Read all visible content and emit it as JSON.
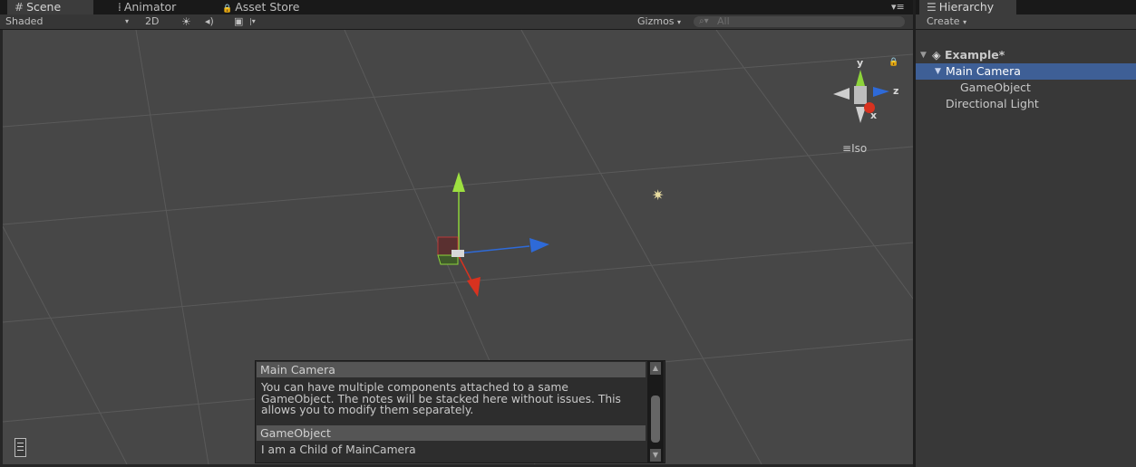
{
  "scene_tabs": [
    {
      "label": "Scene",
      "icon": "grid-icon",
      "icon_glyph": "#"
    },
    {
      "label": "Animator",
      "icon": "animator-icon",
      "icon_glyph": "⁞"
    },
    {
      "label": "Asset Store",
      "icon": "lock-icon",
      "icon_glyph": "🔒"
    }
  ],
  "scene_toolbar": {
    "shading": "Shaded",
    "mode_2d": "2D",
    "gizmos": "Gizmos",
    "search_placeholder": "All"
  },
  "orientation": {
    "y_label": "y",
    "z_label": "z",
    "x_label": "x",
    "projection": "Iso"
  },
  "notes": [
    {
      "title": "Main Camera",
      "body": "You can have multiple components attached to a same GameObject. The notes will be stacked here without issues. This allows you to modify them separately."
    },
    {
      "title": "GameObject",
      "body": "I am a Child of MainCamera"
    }
  ],
  "hierarchy": {
    "tab": "Hierarchy",
    "create": "Create",
    "scene": "Example*",
    "items": [
      {
        "label": "Main Camera",
        "selected": true
      },
      {
        "label": "GameObject",
        "selected": false
      },
      {
        "label": "Directional Light",
        "selected": false
      }
    ]
  },
  "colors": {
    "selection": "#3e5f96",
    "viewport": "#474747",
    "x_axis": "#d8321f",
    "y_axis": "#8dd43a",
    "z_axis": "#2e6ad8"
  }
}
